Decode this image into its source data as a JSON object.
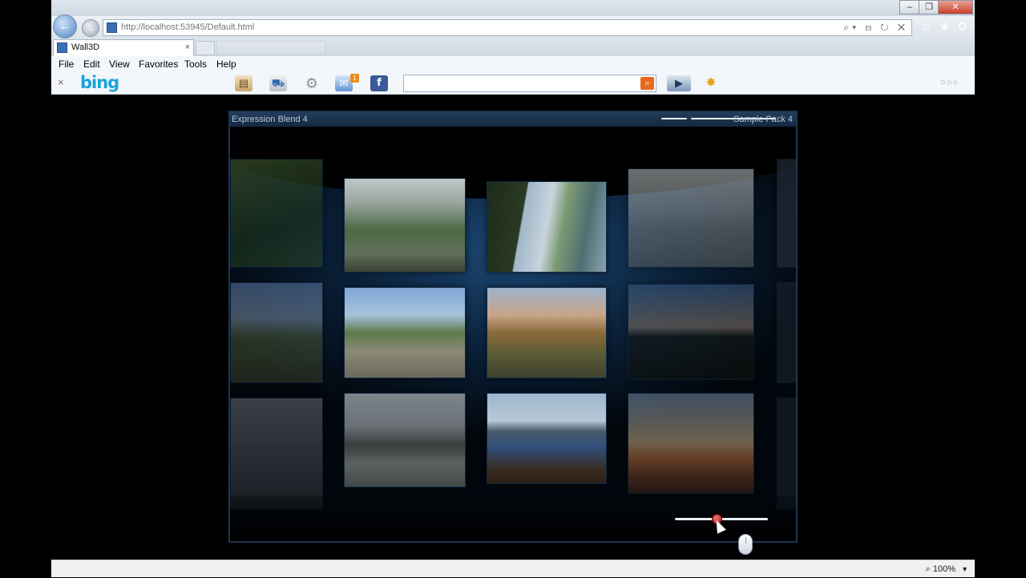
{
  "browser": {
    "url": "http://localhost:53945/Default.html",
    "tab_title": "Wall3D",
    "tab_close": "×",
    "window_controls": {
      "minimize": "–",
      "restore": "❐",
      "close": "✕"
    },
    "address_tools": "⌕▾ ⊟ ↻ ✕",
    "back_label": "←",
    "forward_label": "→"
  },
  "menu": {
    "items": [
      "File",
      "Edit",
      "View",
      "Favorites",
      "Tools",
      "Help"
    ]
  },
  "bing_bar": {
    "close": "×",
    "logo": "bing",
    "search_placeholder": "",
    "search_button": "⌕",
    "overflow": "○○○",
    "icons": [
      "newspaper-icon",
      "car-icon",
      "gear-icon",
      "mail-icon",
      "facebook-icon",
      "video-icon",
      "sparkle-icon"
    ],
    "mail_badge": "1"
  },
  "app": {
    "title": "Expression Blend 4",
    "right_label": "Sample Pack 4",
    "zoom_slider_value": 0.45
  },
  "status_bar": {
    "zoom": "100%",
    "zoom_arrow": "▼"
  }
}
